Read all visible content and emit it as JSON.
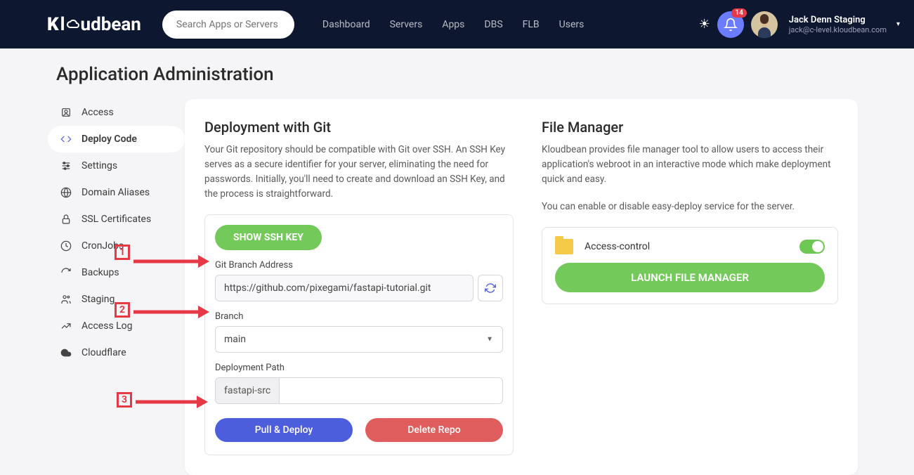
{
  "header": {
    "logo_text": "Kloudbean",
    "search_placeholder": "Search Apps or Servers",
    "nav": [
      "Dashboard",
      "Servers",
      "Apps",
      "DBS",
      "FLB",
      "Users"
    ],
    "notification_count": "14",
    "user_name": "Jack Denn Staging",
    "user_email": "jack@c-level.kloudbean.com"
  },
  "page_title": "Application Administration",
  "sidebar": {
    "items": [
      {
        "label": "Access"
      },
      {
        "label": "Deploy Code"
      },
      {
        "label": "Settings"
      },
      {
        "label": "Domain Aliases"
      },
      {
        "label": "SSL Certificates"
      },
      {
        "label": "CronJobs"
      },
      {
        "label": "Backups"
      },
      {
        "label": "Staging"
      },
      {
        "label": "Access Log"
      },
      {
        "label": "Cloudflare"
      }
    ]
  },
  "deploy": {
    "title": "Deployment with Git",
    "desc": "Your Git repository should be compatible with Git over SSH. An SSH Key serves as a secure identifier for your server, eliminating the need for passwords. Initially, you'll need to create and download an SSH Key, and the process is straightforward.",
    "ssh_btn": "SHOW SSH KEY",
    "git_label": "Git Branch Address",
    "git_value": "https://github.com/pixegami/fastapi-tutorial.git",
    "branch_label": "Branch",
    "branch_value": "main",
    "path_label": "Deployment Path",
    "path_prefix": "fastapi-src",
    "pull_btn": "Pull & Deploy",
    "delete_btn": "Delete Repo"
  },
  "filemgr": {
    "title": "File Manager",
    "desc": "Kloudbean provides file manager tool to allow users to access their application's webroot in an interactive mode which make deployment quick and easy.",
    "note": "You can enable or disable easy-deploy service for the server.",
    "toggle_label": "Access-control",
    "launch_btn": "LAUNCH FILE MANAGER"
  },
  "annotations": {
    "a1": "1",
    "a2": "2",
    "a3": "3"
  }
}
